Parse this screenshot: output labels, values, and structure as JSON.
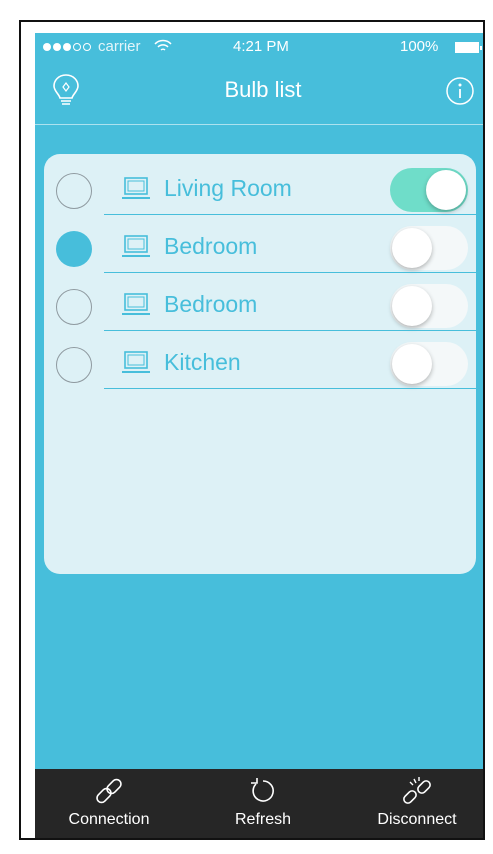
{
  "status_bar": {
    "carrier": "carrier",
    "time": "4:21 PM",
    "battery": "100%",
    "signal_bars_filled": 3,
    "signal_bars_total": 5
  },
  "nav": {
    "title": "Bulb list",
    "left_icon": "lightbulb-icon",
    "right_icon": "info-icon"
  },
  "bulbs": [
    {
      "name": "Living Room",
      "selected": false,
      "on": true
    },
    {
      "name": "Bedroom",
      "selected": true,
      "on": false
    },
    {
      "name": "Bedroom",
      "selected": false,
      "on": false
    },
    {
      "name": "Kitchen",
      "selected": false,
      "on": false
    }
  ],
  "tabbar": {
    "items": [
      {
        "label": "Connection",
        "icon": "link-icon"
      },
      {
        "label": "Refresh",
        "icon": "refresh-icon"
      },
      {
        "label": "Disconnect",
        "icon": "broken-link-icon"
      }
    ]
  },
  "colors": {
    "accent": "#47bedb",
    "card_bg": "#ddf1f6",
    "toggle_on": "#6fddc9",
    "tabbar_bg": "#262626"
  }
}
